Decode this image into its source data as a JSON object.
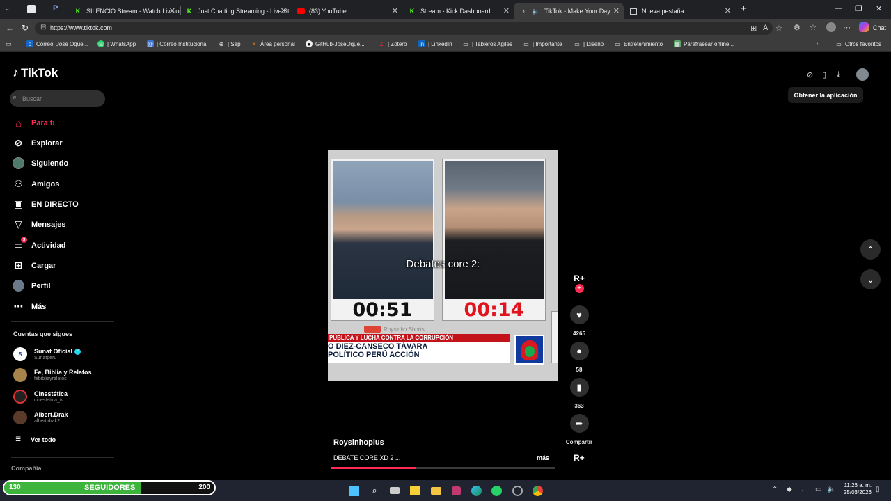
{
  "browser": {
    "tabs": [
      {
        "label": "SILENCIO Stream - Watch Live on",
        "favicon": "kick-icon",
        "color": "#53fc18"
      },
      {
        "label": "Just Chatting Streaming - Live Stre",
        "favicon": "kick-icon",
        "color": "#53fc18"
      },
      {
        "label": "(83) YouTube",
        "favicon": "youtube-icon",
        "color": "#ff0000"
      },
      {
        "label": "Stream - Kick Dashboard",
        "favicon": "kick-icon",
        "color": "#53fc18"
      },
      {
        "label": "TikTok - Make Your Day",
        "favicon": "tiktok-icon",
        "color": "#ffffff"
      },
      {
        "label": "Nueva pestaña",
        "favicon": "newtab-icon",
        "color": "#cccccc"
      }
    ],
    "url": "https://www.tiktok.com",
    "bookmarks": [
      "Correo: Jose Oque...",
      "| WhatsApp",
      "| Correo Institucional",
      "| Sap",
      "Área personal",
      "GitHub-JoseOque...",
      "| Zotero",
      "| LinkedIn",
      "| Tableros Agiles",
      "| Importante",
      "| Diseño",
      "Entretenimiento",
      "Parafrasear online...",
      "Otros favoritos"
    ],
    "chat_label": "Chat"
  },
  "tiktok": {
    "logo": "TikTok",
    "search_placeholder": "Buscar",
    "nav": [
      {
        "label": "Para ti",
        "icon": "home-icon"
      },
      {
        "label": "Explorar",
        "icon": "compass-icon"
      },
      {
        "label": "Siguiendo",
        "icon": "avatar"
      },
      {
        "label": "Amigos",
        "icon": "friends-icon"
      },
      {
        "label": "EN DIRECTO",
        "icon": "live-icon"
      },
      {
        "label": "Mensajes",
        "icon": "inbox-icon"
      },
      {
        "label": "Actividad",
        "icon": "activity-icon",
        "badge": "3"
      },
      {
        "label": "Cargar",
        "icon": "upload-icon"
      },
      {
        "label": "Perfil",
        "icon": "profile-icon"
      },
      {
        "label": "Más",
        "icon": "more-icon"
      }
    ],
    "following_title": "Cuentas que sigues",
    "following": [
      {
        "name": "Sunat Oficial",
        "handle": "Sunatperu",
        "verified": true
      },
      {
        "name": "Fe, Biblia y Relatos",
        "handle": "febibliayrelatos"
      },
      {
        "name": "Cinestética",
        "handle": "cinestetica_tv"
      },
      {
        "name": "Albert.Drak",
        "handle": "albert.drak2"
      }
    ],
    "see_all": "Ver todo",
    "company": "Compañía",
    "tooltip": "Obtener la aplicación",
    "video": {
      "overlay_text": "Debates core 2:",
      "timer_left": "00:51",
      "timer_right": "00:14",
      "yt_watermark": "Roysinho Shorts",
      "chyron_top": "PÚBLICA Y LUCHA CONTRA LA CORRUPCIÓN",
      "chyron_line1": "O DIEZ-CANSECO TÁVARA",
      "chyron_line2": "POLÍTICO PERÚ ACCIÓN",
      "progress": 0.38
    },
    "author": "Roysinhoplus",
    "description": "DEBATE CORE XD 2 ...",
    "more": "más",
    "actions": {
      "likes": "4265",
      "comments": "58",
      "saves": "363",
      "share": "Compartir"
    }
  },
  "overlay_widget": {
    "current": "130",
    "label": "SEGUIDORES",
    "goal": "200",
    "fraction": 0.65
  },
  "taskbar": {
    "time": "11:26 a. m.",
    "date": "25/03/2026"
  }
}
